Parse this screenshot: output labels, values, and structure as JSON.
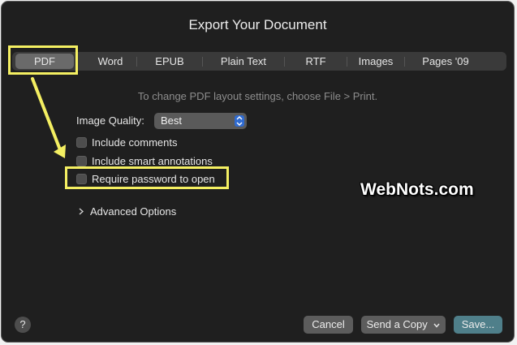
{
  "dialog": {
    "title": "Export Your Document"
  },
  "tabs": [
    "PDF",
    "Word",
    "EPUB",
    "Plain Text",
    "RTF",
    "Images",
    "Pages '09"
  ],
  "info_text": "To change PDF layout settings, choose File > Print.",
  "image_quality": {
    "label": "Image Quality:",
    "value": "Best"
  },
  "options": {
    "include_comments": "Include comments",
    "include_smart_annotations": "Include smart annotations",
    "require_password": "Require password to open"
  },
  "advanced": {
    "label": "Advanced Options"
  },
  "watermark": "WebNots.com",
  "buttons": {
    "help": "?",
    "cancel": "Cancel",
    "send_copy": "Send a Copy",
    "save": "Save..."
  },
  "colors": {
    "highlight": "#f4ef62",
    "accent": "#2f6bd1",
    "dialog_bg": "#1f1f1f"
  }
}
